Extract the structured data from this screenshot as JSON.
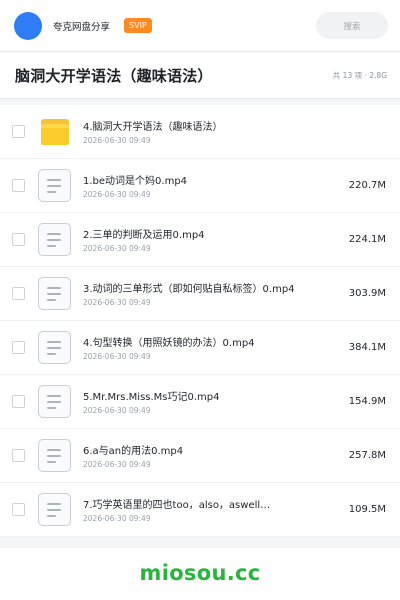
{
  "header": {
    "user_name": "夸克网盘分享",
    "vip_label": "SVIP",
    "search_placeholder": "搜索",
    "avatar_color": "#2f7df6"
  },
  "title_bar": {
    "title": "脑洞大开学语法（趣味语法）",
    "summary": "共 13 项 · 2.8G"
  },
  "files": [
    {
      "type": "folder",
      "icon": "folder-icon",
      "name": "4.脑洞大开学语法（趣味语法）",
      "date": "2026-06-30 09:49",
      "size": ""
    },
    {
      "type": "file",
      "icon": "document-icon",
      "name": "1.be动词是个妈0.mp4",
      "date": "2026-06-30 09:49",
      "size": "220.7M"
    },
    {
      "type": "file",
      "icon": "document-icon",
      "name": "2.三单的判断及运用0.mp4",
      "date": "2026-06-30 09:49",
      "size": "224.1M"
    },
    {
      "type": "file",
      "icon": "document-icon",
      "name": "3.动词的三单形式（即如何贴自私标签）0.mp4",
      "date": "2026-06-30 09:49",
      "size": "303.9M"
    },
    {
      "type": "file",
      "icon": "document-icon",
      "name": "4.句型转换（用照妖镜的办法）0.mp4",
      "date": "2026-06-30 09:49",
      "size": "384.1M"
    },
    {
      "type": "file",
      "icon": "document-icon",
      "name": "5.Mr.Mrs.Miss.Ms巧记0.mp4",
      "date": "2026-06-30 09:49",
      "size": "154.9M"
    },
    {
      "type": "file",
      "icon": "document-icon",
      "name": "6.a与an的用法0.mp4",
      "date": "2026-06-30 09:49",
      "size": "257.8M"
    },
    {
      "type": "file",
      "icon": "document-icon",
      "name": "7.巧学英语里的四也too，also，aswell…",
      "date": "2026-06-30 09:49",
      "size": "109.5M"
    }
  ],
  "watermark": "miosou.cc",
  "colors": {
    "vip": "#ff8a1f",
    "folder": "#fbcb2a",
    "watermark": "#26b53d"
  }
}
